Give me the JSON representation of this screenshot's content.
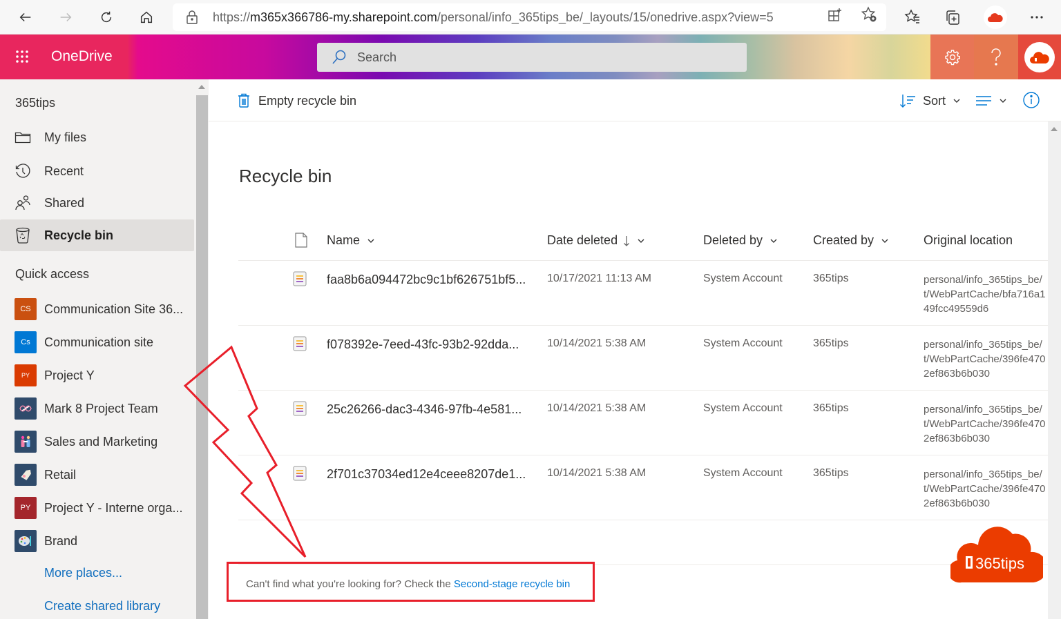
{
  "browser": {
    "url_prefix": "https://",
    "url_host": "m365x366786-my.sharepoint.com",
    "url_path": "/personal/info_365tips_be/_layouts/15/onedrive.aspx?view=5",
    "icons": [
      "back-icon",
      "forward-icon",
      "refresh-icon",
      "home-icon",
      "lock-icon",
      "app-available-icon",
      "add-favorite-icon",
      "favorites-icon",
      "collections-icon",
      "profile-avatar",
      "more-icon"
    ]
  },
  "suite": {
    "app_name": "OneDrive",
    "search_placeholder": "Search",
    "brand_colors": {
      "red": "#e8265e",
      "magenta": "#e40b8c",
      "purple": "#7a0ab0",
      "settings_bg": "#e87556",
      "help_bg": "#e6784f",
      "me_bg": "#e5493c"
    }
  },
  "leftnav": {
    "tenant": "365tips",
    "items": [
      {
        "label": "My files",
        "icon": "folder-icon",
        "selected": false
      },
      {
        "label": "Recent",
        "icon": "history-icon",
        "selected": false
      },
      {
        "label": "Shared",
        "icon": "shared-icon",
        "selected": false
      },
      {
        "label": "Recycle bin",
        "icon": "recycle-bin-icon",
        "selected": true
      }
    ],
    "quick_access_title": "Quick access",
    "sites": [
      {
        "label": "Communication Site 36...",
        "initials": "CS",
        "color": "#ca5010"
      },
      {
        "label": "Communication site",
        "initials": "Cs",
        "color": "#0078d4"
      },
      {
        "label": "Project Y",
        "initials": "PY",
        "color": "#da3b01"
      },
      {
        "label": "Mark 8 Project Team",
        "initials": "",
        "color": "#2f4b6b"
      },
      {
        "label": "Sales and Marketing",
        "initials": "",
        "color": "#2f4b6b"
      },
      {
        "label": "Retail",
        "initials": "",
        "color": "#2f4b6b"
      },
      {
        "label": "Project Y - Interne orga...",
        "initials": "PY",
        "color": "#a4262c"
      },
      {
        "label": "Brand",
        "initials": "",
        "color": "#2f4b6b"
      }
    ],
    "more_places": "More places...",
    "create_library": "Create shared library"
  },
  "commandbar": {
    "empty_label": "Empty recycle bin",
    "sort_label": "Sort"
  },
  "main": {
    "title": "Recycle bin",
    "columns": {
      "name": "Name",
      "date_deleted": "Date deleted",
      "deleted_by": "Deleted by",
      "created_by": "Created by",
      "original_location": "Original location"
    },
    "rows": [
      {
        "name": "faa8b6a094472bc9c1bf626751bf5...",
        "date": "10/17/2021 11:13 AM",
        "deleted_by": "System Account",
        "created_by": "365tips",
        "loc1": "personal/info_365tips_be/",
        "loc2": "t/WebPartCache/bfa716a1",
        "loc3": "49fcc49559d6"
      },
      {
        "name": "f078392e-7eed-43fc-93b2-92dda...",
        "date": "10/14/2021 5:38 AM",
        "deleted_by": "System Account",
        "created_by": "365tips",
        "loc1": "personal/info_365tips_be/",
        "loc2": "t/WebPartCache/396fe470",
        "loc3": "2ef863b6b030"
      },
      {
        "name": "25c26266-dac3-4346-97fb-4e581...",
        "date": "10/14/2021 5:38 AM",
        "deleted_by": "System Account",
        "created_by": "365tips",
        "loc1": "personal/info_365tips_be/",
        "loc2": "t/WebPartCache/396fe470",
        "loc3": "2ef863b6b030"
      },
      {
        "name": "2f701c37034ed12e4ceee8207de1...",
        "date": "10/14/2021 5:38 AM",
        "deleted_by": "System Account",
        "created_by": "365tips",
        "loc1": "personal/info_365tips_be/",
        "loc2": "t/WebPartCache/396fe470",
        "loc3": "2ef863b6b030"
      }
    ],
    "footer_text": "Can't find what you're looking for? Check the ",
    "footer_link": "Second-stage recycle bin"
  },
  "watermark": {
    "text": "365tips",
    "color": "#eb3c00"
  },
  "annotation": {
    "color": "#e81f2a"
  }
}
